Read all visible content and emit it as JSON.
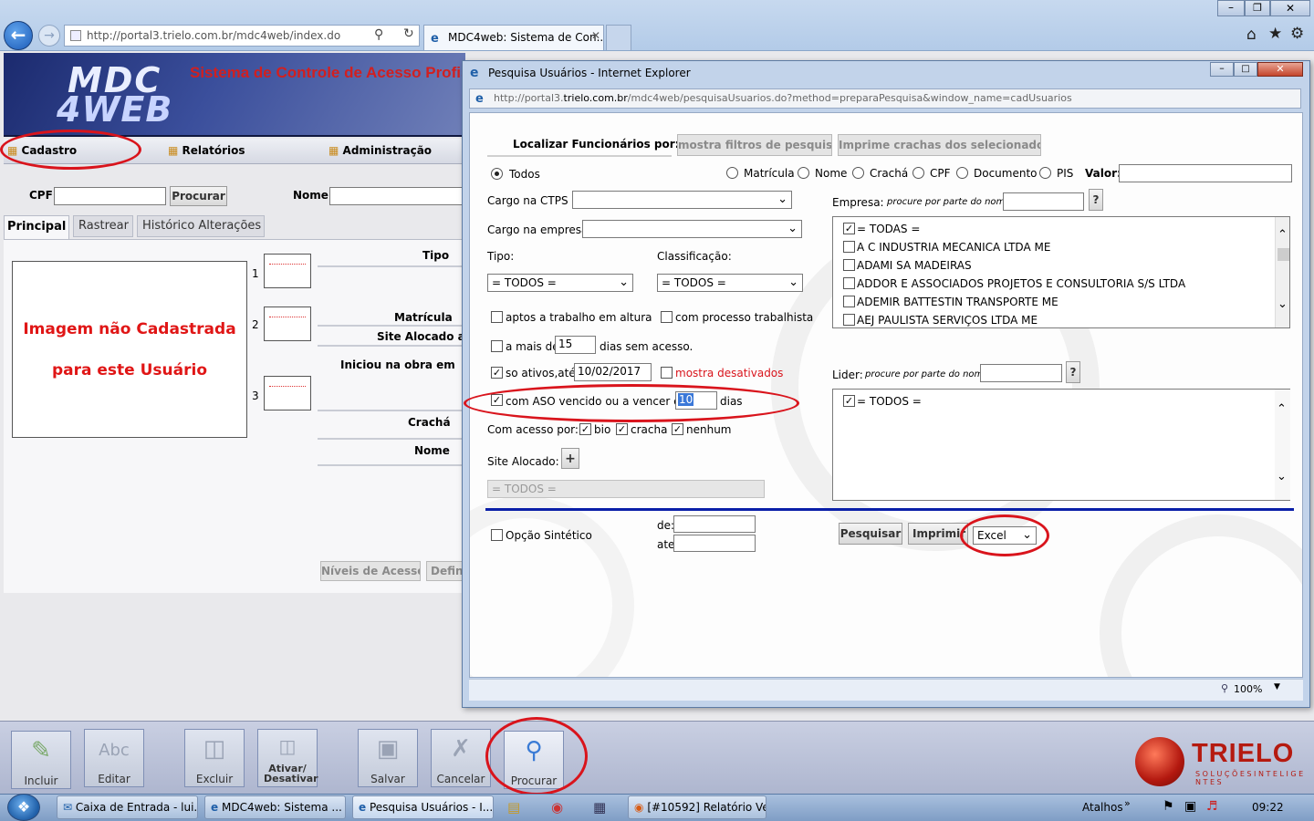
{
  "browser": {
    "url": "http://portal3.trielo.com.br/mdc4web/index.do",
    "url_host": "portal3.",
    "url_domain": "trielo.com.br",
    "url_path": "/mdc4web/index.do",
    "tab_title": "MDC4web: Sistema de Con..."
  },
  "app": {
    "logo_line1": "MDC",
    "logo_line2": "4WEB",
    "title": "Sistema de Controle de Acesso Profiss",
    "menu": [
      "Cadastro",
      "Relatórios",
      "Administração"
    ],
    "cpf_label": "CPF",
    "procurar": "Procurar",
    "nome_label": "Nome",
    "tabs": [
      "Principal",
      "Rastrear",
      "Histórico Alterações"
    ],
    "image_missing_line1": "Imagem não Cadastrada",
    "image_missing_line2": "para este Usuário",
    "thumb_numbers": [
      "1",
      "2",
      "3"
    ],
    "fields": [
      "Tipo",
      "Matrícula",
      "Site Alocado a",
      "Iniciou na obra em",
      "Crachá",
      "Nome"
    ],
    "niveis_acesso": "Níveis de Acesso",
    "defin": "Defin"
  },
  "toolbar": [
    "Incluir",
    "Editar",
    "Excluir",
    "Ativar/ Desativar",
    "Salvar",
    "Cancelar",
    "Procurar"
  ],
  "brand": {
    "name": "TRIELO",
    "tagline": "S O L U Ç Õ E S  I N T E L I G E N T E S"
  },
  "popup": {
    "title": "Pesquisa Usuários - Internet Explorer",
    "url_host": "http://portal3.",
    "url_domain": "trielo.com.br",
    "url_path": "/mdc4web/pesquisaUsuarios.do?method=preparaPesquisa&window_name=cadUsuarios",
    "localizar_label": "Localizar Funcionários por:",
    "btn_filtros": "mostra filtros de pesquisa",
    "btn_imprime_crachas": "Imprime crachas dos selecionados",
    "search_modes": [
      "Todos",
      "Matrícula",
      "Nome",
      "Crachá",
      "CPF",
      "Documento",
      "PIS"
    ],
    "valor_label": "Valor:",
    "cargo_ctps_label": "Cargo na CTPS",
    "cargo_empresa_label": "Cargo na empresa",
    "empresa_label": "Empresa:",
    "procure_hint": "procure por parte do nome",
    "help_btn": "?",
    "tipo_label": "Tipo:",
    "classificacao_label": "Classificação:",
    "tipo_value": "= TODOS =",
    "classificacao_value": "= TODOS =",
    "empresas": [
      {
        "name": "= TODAS =",
        "checked": true
      },
      {
        "name": "A C INDUSTRIA MECANICA LTDA ME",
        "checked": false
      },
      {
        "name": "ADAMI SA MADEIRAS",
        "checked": false
      },
      {
        "name": "ADDOR E ASSOCIADOS PROJETOS E CONSULTORIA S/S LTDA",
        "checked": false
      },
      {
        "name": "ADEMIR BATTESTIN TRANSPORTE ME",
        "checked": false
      },
      {
        "name": "AEJ PAULISTA SERVIÇOS LTDA ME",
        "checked": false
      }
    ],
    "aptos_altura": "aptos a trabalho em altura",
    "processo_trabalhista": "com processo trabalhista",
    "a_mais_de": "a mais de",
    "dias_value": "15",
    "dias_sem_acesso": "dias sem acesso.",
    "so_ativos": "so ativos,até:",
    "so_ativos_date": "10/02/2017",
    "mostra_desativados": "mostra desativados",
    "lider_label": "Lider:",
    "aso_label": "com ASO vencido ou a vencer em",
    "aso_value": "10",
    "dias": "dias",
    "lideres": [
      {
        "name": "= TODOS =",
        "checked": true
      }
    ],
    "com_acesso": "Com acesso por:",
    "acesso_opts": [
      "bio",
      "cracha",
      "nenhum"
    ],
    "site_alocado_label": "Site Alocado:",
    "plus": "+",
    "site_todos": "= TODOS =",
    "opcao_sintetico": "Opção Sintético",
    "de_label": "de:",
    "ate_label": "ate",
    "btn_pesquisar": "Pesquisar",
    "btn_imprimir": "Imprimir",
    "export_format": "Excel",
    "zoom": "100%"
  },
  "taskbar": {
    "items": [
      "Caixa de Entrada - lui...",
      "MDC4web: Sistema ...",
      "Pesquisa Usuários - I...",
      "[#10592] Relatório Ve..."
    ],
    "atalhos": "Atalhos",
    "clock": "09:22"
  },
  "colors": {
    "accent_red": "#d9141c",
    "ie_blue": "#1f5fa8",
    "separator_blue": "#0a1fa8"
  }
}
